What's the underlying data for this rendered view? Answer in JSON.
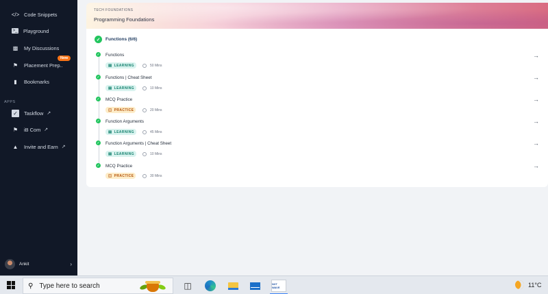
{
  "sidebar": {
    "items": [
      {
        "label": "Code Snippets",
        "icon": "code-icon"
      },
      {
        "label": "Playground",
        "icon": "terminal-icon"
      },
      {
        "label": "My Discussions",
        "icon": "discussion-icon"
      },
      {
        "label": "Placement Prep..",
        "icon": "placement-icon"
      },
      {
        "label": "Bookmarks",
        "icon": "bookmark-icon"
      }
    ],
    "new_badge": "New",
    "apps_label": "APPS",
    "apps": [
      {
        "label": "Taskflow",
        "icon": "checkbox-icon"
      },
      {
        "label": "iB Com",
        "icon": "flag-icon"
      },
      {
        "label": "Invite and Earn",
        "icon": "gift-icon"
      }
    ],
    "profile_name": "Ankit"
  },
  "banner": {
    "subtitle": "TECH FOUNDATIONS",
    "title": "Programming Foundations"
  },
  "section": {
    "title": "Functions (6/6)"
  },
  "items": [
    {
      "title": "Functions",
      "type": "LEARNING",
      "duration": "50 Mins"
    },
    {
      "title": "Functions | Cheat Sheet",
      "type": "LEARNING",
      "duration": "10 Mins"
    },
    {
      "title": "MCQ Practice",
      "type": "PRACTICE",
      "duration": "20 Mins"
    },
    {
      "title": "Function Arguments",
      "type": "LEARNING",
      "duration": "45 Mins"
    },
    {
      "title": "Function Arguments | Cheat Sheet",
      "type": "LEARNING",
      "duration": "10 Mins"
    },
    {
      "title": "MCQ Practice",
      "type": "PRACTICE",
      "duration": "30 Mins"
    }
  ],
  "taskbar": {
    "search_placeholder": "Type here to search",
    "app_icon_text": "NXT WAVE",
    "weather": "11°C"
  },
  "colors": {
    "sidebar_bg": "#111827",
    "success": "#22c55e",
    "learning_bg": "#d9f3ef",
    "practice_bg": "#fdecc8",
    "new_badge": "#f97316"
  }
}
